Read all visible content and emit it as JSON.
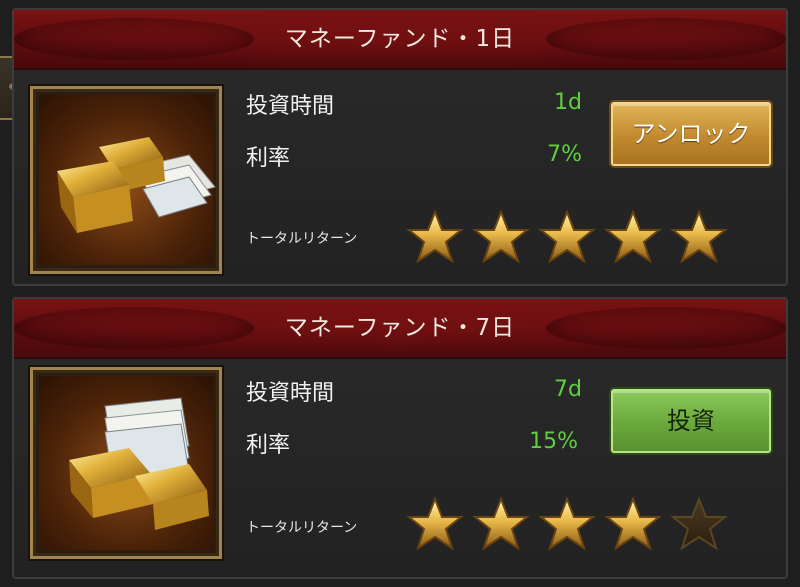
{
  "funds": [
    {
      "title": "マネーファンド・1日",
      "time_label": "投資時間",
      "time_value": "1d",
      "rate_label": "利率",
      "rate_value": "7%",
      "total_label": "トータルリターン",
      "stars_filled": 5,
      "stars_total": 5,
      "button_label": "アンロック",
      "button_color": "#c28a30"
    },
    {
      "title": "マネーファンド・7日",
      "time_label": "投資時間",
      "time_value": "7d",
      "rate_label": "利率",
      "rate_value": "15%",
      "total_label": "トータルリターン",
      "stars_filled": 4,
      "stars_total": 5,
      "button_label": "投資",
      "button_color": "#6aa83c"
    }
  ],
  "colors": {
    "banner_red": "#6e1012",
    "value_green": "#5fcf3f",
    "star_gold": "#e8b84a"
  },
  "icons": {
    "fund_image": "gold-bars-and-banknotes-icon",
    "side_tab": "scroll-icon"
  }
}
